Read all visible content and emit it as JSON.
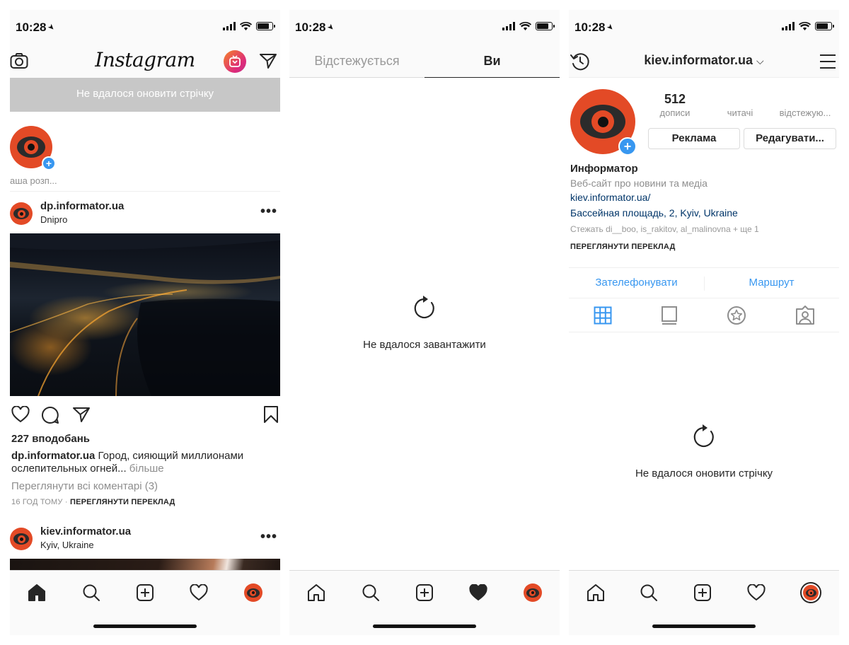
{
  "status": {
    "time": "10:28"
  },
  "screen1": {
    "logo": "Instagram",
    "banner": "Не вдалося оновити стрічку",
    "story_label": "аша розп...",
    "post1": {
      "username": "dp.informator.ua",
      "location": "Dnipro",
      "likes": "227 вподобань",
      "caption_user": "dp.informator.ua",
      "caption_text": " Город, сияющий миллионами ослепительных огней...",
      "caption_more": " більше",
      "comments": "Переглянути всі коментарі (3)",
      "time": "16 ГОД ТОМУ",
      "time_sep": " · ",
      "translate": "ПЕРЕГЛЯНУТИ ПЕРЕКЛАД"
    },
    "post2": {
      "username": "kiev.informator.ua",
      "location": "Kyiv, Ukraine"
    }
  },
  "screen2": {
    "tab_following": "Відстежується",
    "tab_you": "Ви",
    "error": "Не вдалося завантажити"
  },
  "screen3": {
    "username": "kiev.informator.ua",
    "posts_count": "512",
    "posts_label": "дописи",
    "followers_label": "читачі",
    "following_label": "відстежую...",
    "btn_promote": "Реклама",
    "btn_edit": "Редагувати...",
    "full_name": "Информатор",
    "category": "Веб-сайт про новини та медіа",
    "link": "kiev.informator.ua/",
    "address": "Бассейная площадь, 2, Kyiv, Ukraine",
    "followed_by": "Стежать di__boo, is_rakitov, al_malinovna + ще 1",
    "translate": "ПЕРЕГЛЯНУТИ ПЕРЕКЛАД",
    "call": "Зателефонувати",
    "route": "Маршрут",
    "error": "Не вдалося оновити стрічку"
  },
  "colors": {
    "accent_blue": "#3897f0",
    "brand_red": "#e34a26",
    "text": "#262626",
    "muted": "#8e8e8e"
  },
  "icons": [
    "camera-icon",
    "igtv-icon",
    "direct-icon",
    "heart-icon",
    "comment-icon",
    "share-icon",
    "bookmark-icon",
    "home-icon",
    "search-icon",
    "add-icon",
    "profile-avatar",
    "refresh-icon",
    "history-icon",
    "menu-icon",
    "grid-icon",
    "list-icon",
    "saved-star-icon",
    "tagged-icon"
  ]
}
